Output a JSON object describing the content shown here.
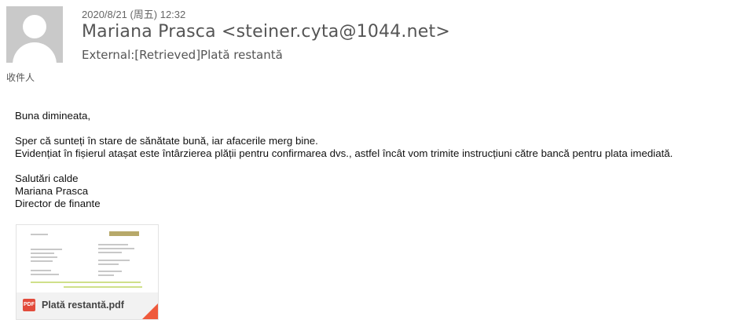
{
  "email": {
    "timestamp": "2020/8/21 (周五) 12:32",
    "sender": "Mariana Prasca <steiner.cyta@1044.net>",
    "subject": "External:[Retrieved]Plată restantă",
    "recipient_label": "收件人"
  },
  "body": {
    "greeting": "Buna dimineata,",
    "line1": "Sper că sunteți în stare de sănătate bună, iar afacerile merg bine.",
    "line2": "Evidențiat în fișierul atașat este întârzierea plății pentru confirmarea dvs., astfel încât vom trimite instrucțiuni către bancă pentru plata imediată.",
    "closing": "Salutări calde",
    "name": "Mariana Prasca",
    "title": "Director de finante"
  },
  "attachment": {
    "file_name": "Plată restantă.pdf",
    "icon_label": "PDF",
    "icon": "pdf-icon",
    "accent_color": "#ef5a3c"
  },
  "avatar": {
    "icon": "user-placeholder-icon"
  }
}
